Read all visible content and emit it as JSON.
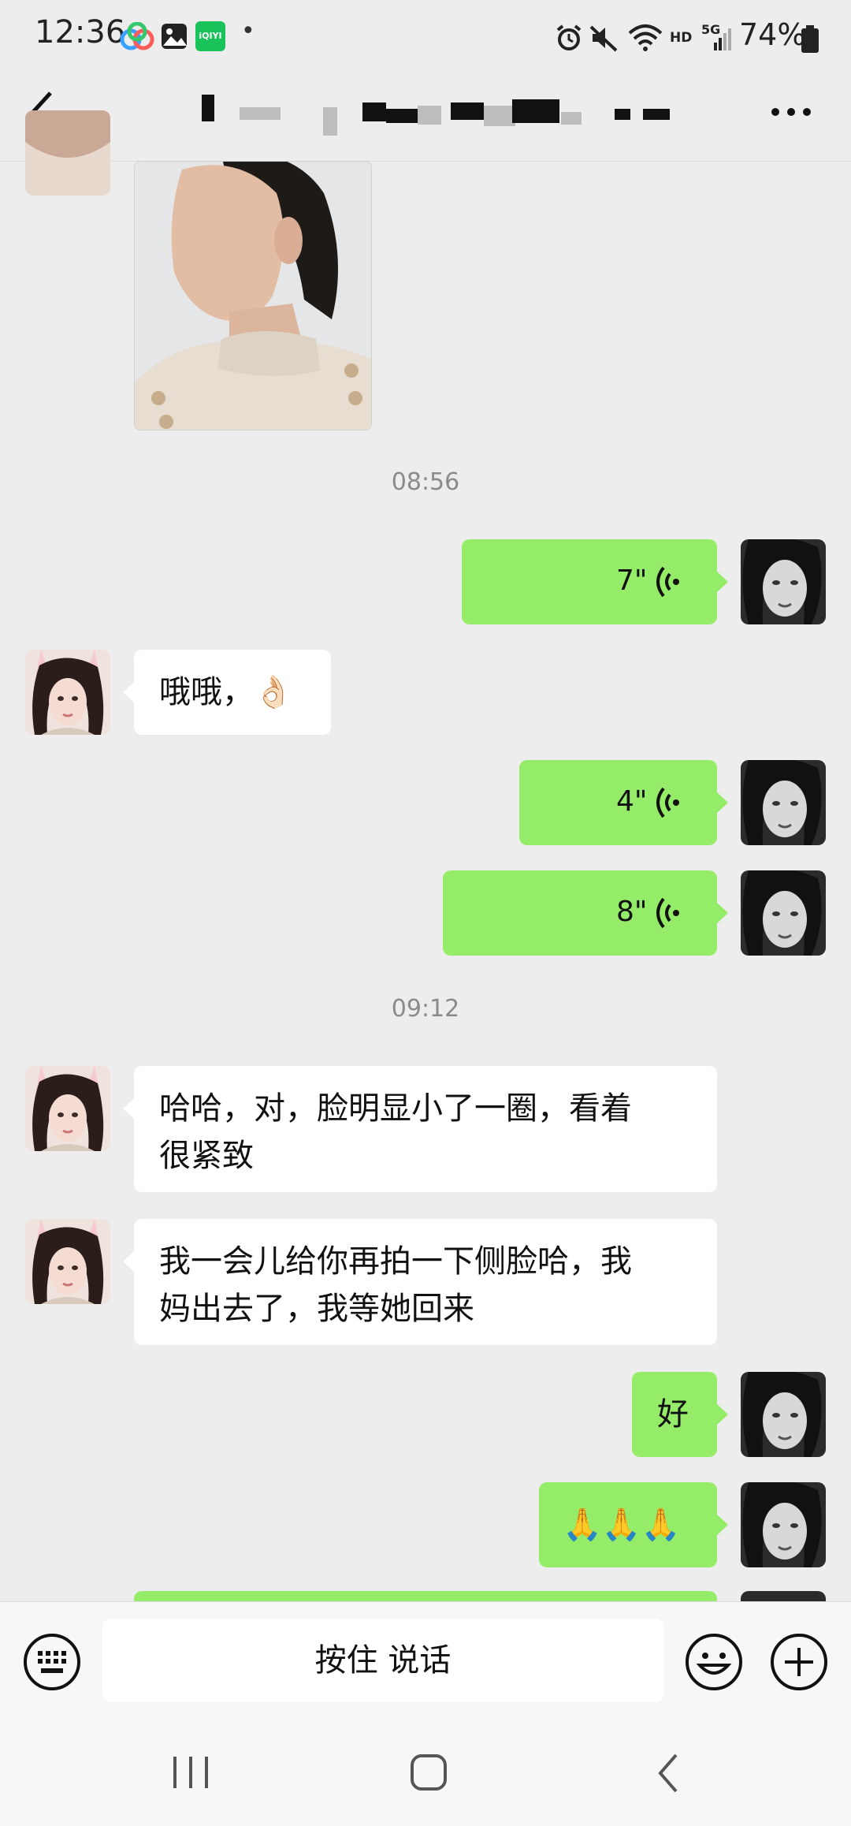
{
  "status_bar": {
    "time": "12:36",
    "battery": "74%",
    "app_icons": [
      "baidu-netdisk-icon",
      "gallery-icon",
      "iqiyi-icon"
    ],
    "iqiyi_label": "iQIYI",
    "dot": "•",
    "hd": "HD",
    "net": "5G"
  },
  "nav": {
    "back_icon": "back-chevron-icon",
    "title": "",
    "more_icon": "more-dots-icon"
  },
  "messages": [
    {
      "type": "image",
      "side": "left",
      "alt": ""
    },
    {
      "type": "time",
      "text": "08:56"
    },
    {
      "type": "voice",
      "side": "right",
      "duration": "7\""
    },
    {
      "type": "text",
      "side": "left",
      "text": "哦哦，👌🏻"
    },
    {
      "type": "voice",
      "side": "right",
      "duration": "4\""
    },
    {
      "type": "voice",
      "side": "right",
      "duration": "8\""
    },
    {
      "type": "time",
      "text": "09:12"
    },
    {
      "type": "text",
      "side": "left",
      "lines": [
        "哈哈，对，脸明显小了一圈，看着",
        "很紧致"
      ]
    },
    {
      "type": "text",
      "side": "left",
      "lines": [
        "我一会儿给你再拍一下侧脸哈，我",
        "妈出去了，我等她回来"
      ]
    },
    {
      "type": "text",
      "side": "right",
      "text": "好"
    },
    {
      "type": "text",
      "side": "right",
      "text": "🙏🙏🙏"
    }
  ],
  "input": {
    "hold_to_talk": "按住 说话",
    "keyboard_icon": "keyboard-icon",
    "emoji_icon": "emoji-icon",
    "plus_icon": "plus-icon"
  },
  "system_nav": {
    "recent_icon": "recent-apps-icon",
    "home_icon": "home-icon",
    "back_icon": "back-icon"
  },
  "colors": {
    "background": "#ededed",
    "green_bubble": "#95ec69",
    "white_bubble": "#ffffff"
  }
}
